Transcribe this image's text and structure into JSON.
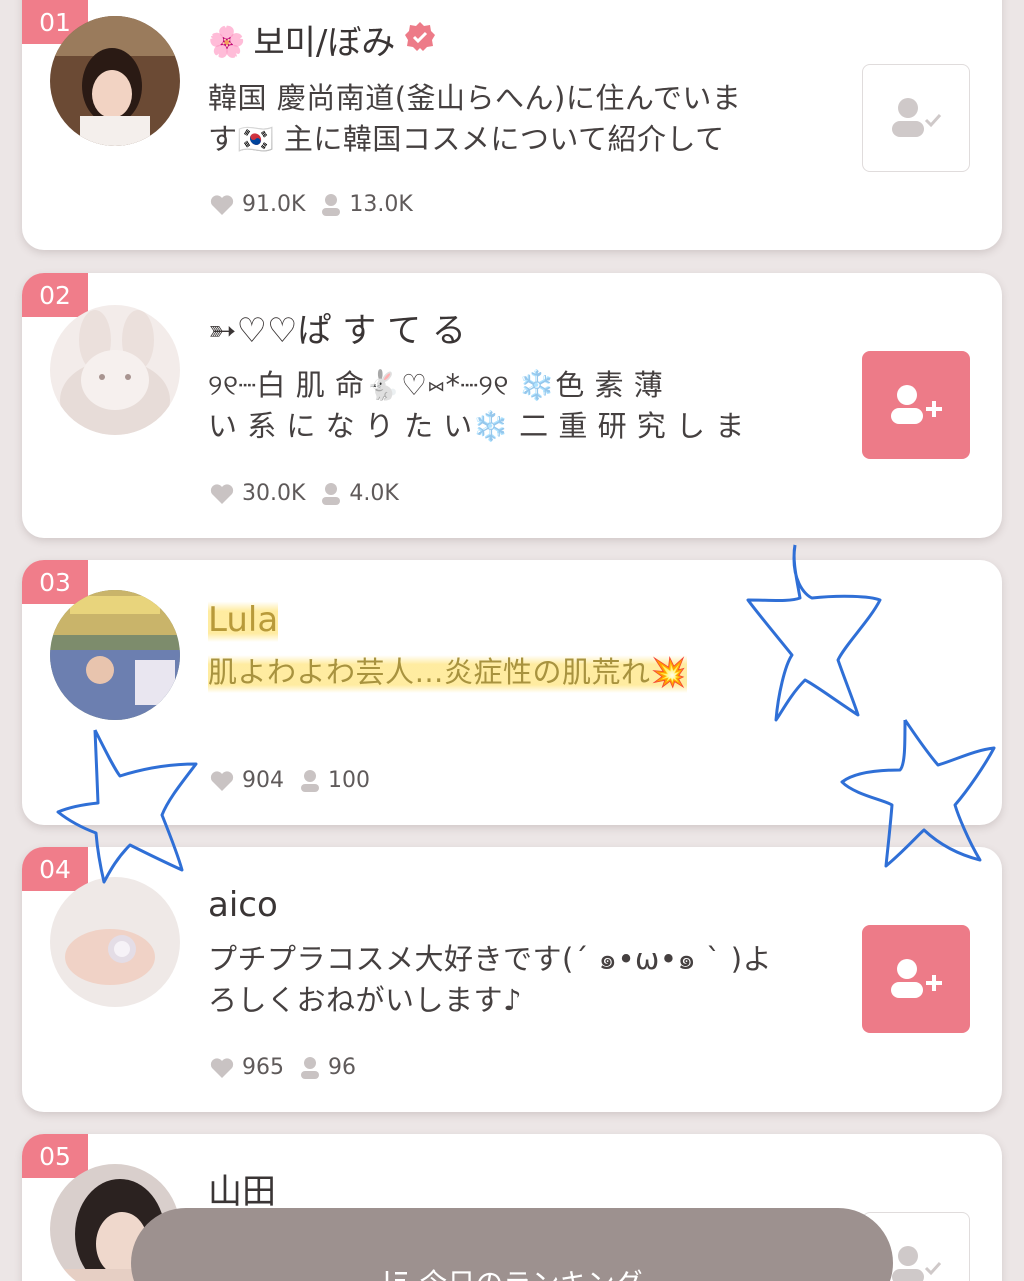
{
  "ranking": [
    {
      "rank": "01",
      "name": "보미/ぼみ",
      "bio_lines": [
        "韓国 慶尚南道(釜山らへん)に住んでいま",
        "す🇰🇷 主に韓国コスメについて紹介して"
      ],
      "likes": "91.0K",
      "followers": "13.0K",
      "following": true,
      "verified": true
    },
    {
      "rank": "02",
      "name": "➳♡♡ぱ す て る",
      "bio_lines": [
        "୨୧┈白 肌 命🐇♡⑅*┈୨୧   ❄️色 素 薄",
        "い 系 に な り た い❄️  二 重 研 究 し ま"
      ],
      "likes": "30.0K",
      "followers": "4.0K",
      "following": false
    },
    {
      "rank": "03",
      "name": "Lula",
      "bio_lines": [
        "肌よわよわ芸人…炎症性の肌荒れ💥"
      ],
      "likes": "904",
      "followers": "100",
      "following": null
    },
    {
      "rank": "04",
      "name": "aico",
      "bio_lines": [
        "プチプラコスメ大好きです(´ ๑•ω•๑ ` )よ",
        "ろしくおねがいします♪"
      ],
      "likes": "965",
      "followers": "96",
      "following": false
    },
    {
      "rank": "05",
      "name": "山田",
      "following": true
    }
  ],
  "bottom_bar": {
    "label": "今日のランキング",
    "icon": "sort-icon"
  },
  "colors": {
    "accent": "#ed7b88",
    "rank_badge": "#f07d8a",
    "background": "#ece6e6",
    "bottom_bar": "#9d918f",
    "doodle": "#2f6fd6",
    "highlight": "#ffe16e"
  }
}
